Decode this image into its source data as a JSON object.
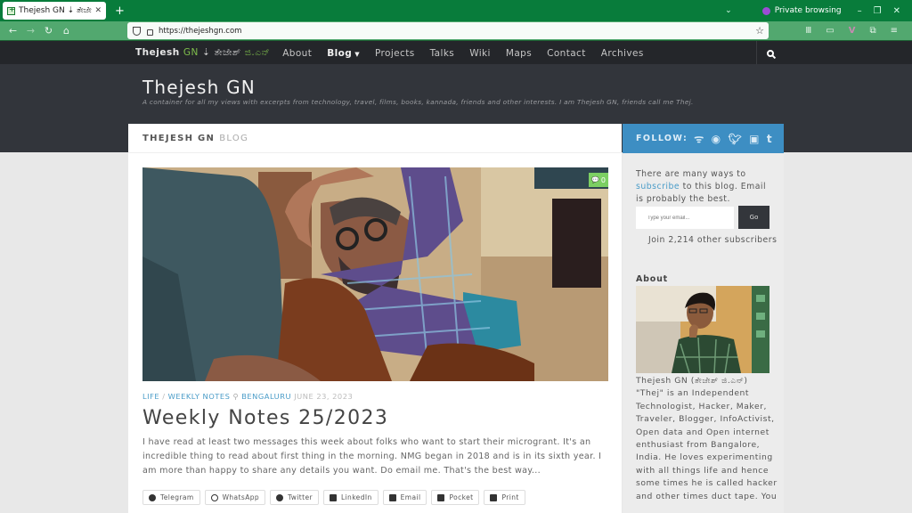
{
  "browser": {
    "tab_title": "Thejesh GN ⇣ ತೇಜೇಶ್ ಜಿ.ಎನ್",
    "new_tab_label": "+",
    "private_label": "Private browsing",
    "url": "https://thejeshgn.com"
  },
  "site_nav": {
    "brand": "Thejesh",
    "brand_gn": "GN",
    "brand_arrow": "⇣",
    "brand_kn": "ತೇಜೇಶ್",
    "brand_kn2": "ಜಿ.ಎನ್",
    "items": [
      {
        "label": "About"
      },
      {
        "label": "Blog",
        "active": true
      },
      {
        "label": "Projects"
      },
      {
        "label": "Talks"
      },
      {
        "label": "Wiki"
      },
      {
        "label": "Maps"
      },
      {
        "label": "Contact"
      },
      {
        "label": "Archives"
      }
    ]
  },
  "hero": {
    "title": "Thejesh GN",
    "tagline": "A container for all my views with excerpts from technology, travel, films, books, kannada, friends and other interests. I am Thejesh GN, friends call me Thej."
  },
  "main": {
    "header_name": "THEJESH GN",
    "header_blog": "BLOG",
    "post": {
      "comment_count": "0",
      "category1": "LIFE",
      "category_sep": "/",
      "category2": "WEEKLY NOTES",
      "location": "BENGALURU",
      "date": "JUNE 23, 2023",
      "title": "Weekly Notes 25/2023",
      "excerpt": "I have read at least two messages this week about folks who want to start their microgrant. It's an incredible thing to read about first thing in the morning. NMG began in 2018 and is in its sixth year. I am more than happy to share any details you want. Do email me. That's the best way...",
      "shares": [
        {
          "label": "Telegram",
          "icon": "telegram-icon"
        },
        {
          "label": "WhatsApp",
          "icon": "whatsapp-icon"
        },
        {
          "label": "Twitter",
          "icon": "twitter-icon"
        },
        {
          "label": "LinkedIn",
          "icon": "linkedin-icon"
        },
        {
          "label": "Email",
          "icon": "email-icon"
        },
        {
          "label": "Pocket",
          "icon": "pocket-icon"
        },
        {
          "label": "Print",
          "icon": "print-icon"
        }
      ]
    }
  },
  "sidebar": {
    "follow_label": "FOLLOW:",
    "subscribe_pre": "There are many ways to ",
    "subscribe_link": "subscribe",
    "subscribe_post": " to this blog. Email is probably the best.",
    "email_placeholder": "Type your email...",
    "go_label": "Go",
    "join_text": "Join 2,214 other subscribers",
    "about_heading": "About",
    "about_text": "Thejesh GN (ತೇಜೇಶ್ ಜಿ.ಎನ್) \"Thej\" is an Independent Technologist, Hacker, Maker, Traveler, Blogger, InfoActivist, Open data and Open internet enthusiast from Bangalore, India. He loves experimenting with all things life and hence some times he is called hacker and other times duct tape. You"
  },
  "colors": {
    "browser_green": "#087c3b",
    "accent_blue": "#3d8ec3",
    "link_blue": "#4a9cc8",
    "brand_green": "#7fbf4c",
    "dark_bg": "#32353b"
  }
}
